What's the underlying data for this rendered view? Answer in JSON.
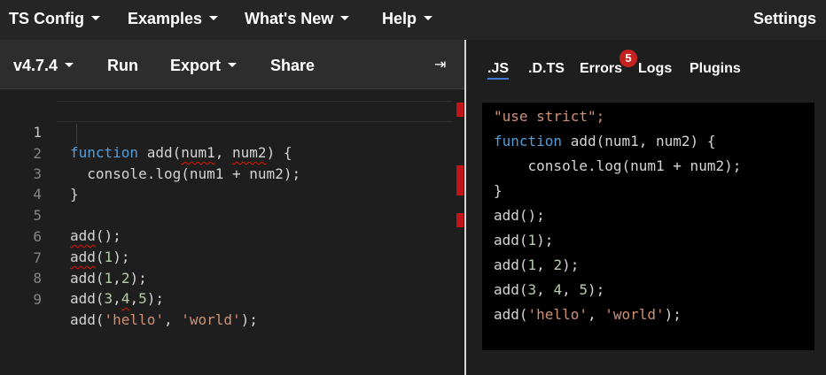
{
  "nav": {
    "ts_config": "TS Config",
    "examples": "Examples",
    "whats_new": "What's New",
    "help": "Help",
    "settings": "Settings"
  },
  "toolbar": {
    "version": "v4.7.4",
    "run": "Run",
    "export": "Export",
    "share": "Share",
    "collapse_icon_glyph": "⇥"
  },
  "editor": {
    "line_numbers": [
      "1",
      "2",
      "3",
      "4",
      "5",
      "6",
      "7",
      "8",
      "9"
    ],
    "lines": [
      {
        "kw": "function",
        "rest_before": " add(",
        "sq1": "num1",
        "mid": ", ",
        "sq2": "num2",
        "rest_after": ") {"
      },
      {
        "text": "  console.log(num1 + num2);"
      },
      {
        "text": "}"
      },
      {
        "text": ""
      },
      {
        "sq": "add",
        "rest": "();"
      },
      {
        "sq": "add",
        "paren_open": "(",
        "num": "1",
        "rest": ");"
      },
      {
        "pre": "add(",
        "n1": "1",
        "comma": ",",
        "n2": "2",
        "rest": ");"
      },
      {
        "pre": "add(",
        "n1": "3",
        "c1": ",",
        "n2": "4",
        "c2": ",",
        "n3": "5",
        "rest": ");"
      },
      {
        "pre": "add(",
        "s1": "'hello'",
        "mid": ", ",
        "s2": "'world'",
        "rest": ");"
      }
    ]
  },
  "right": {
    "tabs": [
      ".JS",
      ".D.TS",
      "Errors",
      "Logs",
      "Plugins"
    ],
    "errors_count": "5"
  },
  "output": {
    "use_strict": "\"use strict\";",
    "l2_kw": "function",
    "l2_rest": " add(num1, num2) {",
    "l3": "    console.log(num1 + num2);",
    "l4": "}",
    "l5": "add();",
    "l6_pre": "add(",
    "l6_n": "1",
    "l6_post": ");",
    "l7_pre": "add(",
    "l7_n1": "1",
    "l7_sep": ", ",
    "l7_n2": "2",
    "l7_post": ");",
    "l8_pre": "add(",
    "l8_n1": "3",
    "l8_sep1": ", ",
    "l8_n2": "4",
    "l8_sep2": ", ",
    "l8_n3": "5",
    "l8_post": ");",
    "l9_pre": "add(",
    "l9_s1": "'hello'",
    "l9_sep": ", ",
    "l9_s2": "'world'",
    "l9_post": ");"
  },
  "colors": {
    "keyword": "#569cd6",
    "string": "#ce9178",
    "number": "#b5cea8",
    "error_badge": "#c5221f",
    "active_tab_underline": "#3f7bd6"
  }
}
